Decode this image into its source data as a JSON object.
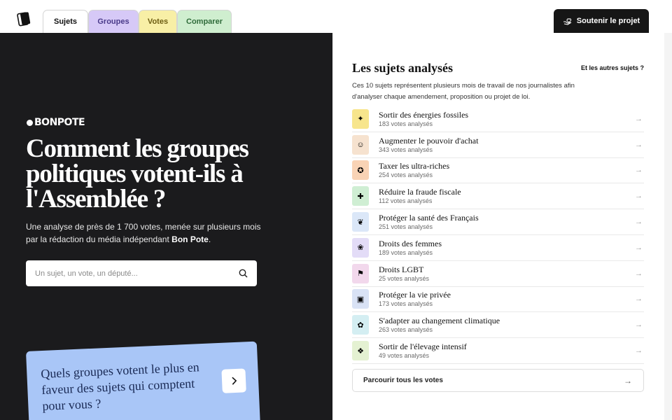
{
  "nav": {
    "tabs": [
      {
        "label": "Sujets"
      },
      {
        "label": "Groupes"
      },
      {
        "label": "Votes"
      },
      {
        "label": "Comparer"
      }
    ],
    "support_label": "Soutenir le projet"
  },
  "hero": {
    "brand": "BONPOTE",
    "title": "Comment les groupes politiques votent-ils à l'Assemblée ?",
    "subtitle_main": "Une analyse de près de 1 700 votes, menée sur plusieurs mois par la rédaction du média indépendant",
    "subtitle_bold": "Bon Pote",
    "subtitle_end": ".",
    "search_placeholder": "Un sujet, un vote, un député...",
    "promo_text": "Quels groupes votent le plus en faveur des sujets qui comptent pour vous ?"
  },
  "panel": {
    "title": "Les sujets analysés",
    "other_link": "Et les autres sujets ?",
    "description": "Ces 10 sujets représentent plusieurs mois de travail de nos journalistes afin d'analyser chaque amendement, proposition ou projet de loi.",
    "topics": [
      {
        "name": "Sortir des énergies fossiles",
        "count": "183 votes analysés",
        "icon": "fossil-fuel-icon",
        "color": "#f7e58c"
      },
      {
        "name": "Augmenter le pouvoir d'achat",
        "count": "343 votes analysés",
        "icon": "purchasing-power-icon",
        "color": "#f6e2cf"
      },
      {
        "name": "Taxer les ultra-riches",
        "count": "254 votes analysés",
        "icon": "tax-rich-icon",
        "color": "#f9d3b5"
      },
      {
        "name": "Réduire la fraude fiscale",
        "count": "112 votes analysés",
        "icon": "tax-fraud-icon",
        "color": "#cfeed3"
      },
      {
        "name": "Protéger la santé des Français",
        "count": "251 votes analysés",
        "icon": "health-icon",
        "color": "#dbe7f8"
      },
      {
        "name": "Droits des femmes",
        "count": "189 votes analysés",
        "icon": "women-rights-icon",
        "color": "#e3dcf7"
      },
      {
        "name": "Droits LGBT",
        "count": "25 votes analysés",
        "icon": "lgbt-icon",
        "color": "#f2d8ec"
      },
      {
        "name": "Protéger la vie privée",
        "count": "173 votes analysés",
        "icon": "privacy-icon",
        "color": "#d9e2f5"
      },
      {
        "name": "S'adapter au changement climatique",
        "count": "263 votes analysés",
        "icon": "climate-adapt-icon",
        "color": "#d4eef2"
      },
      {
        "name": "Sortir de l'élevage intensif",
        "count": "49 votes analysés",
        "icon": "farming-icon",
        "color": "#e4f1d2"
      }
    ],
    "browse_label": "Parcourir tous les votes"
  }
}
